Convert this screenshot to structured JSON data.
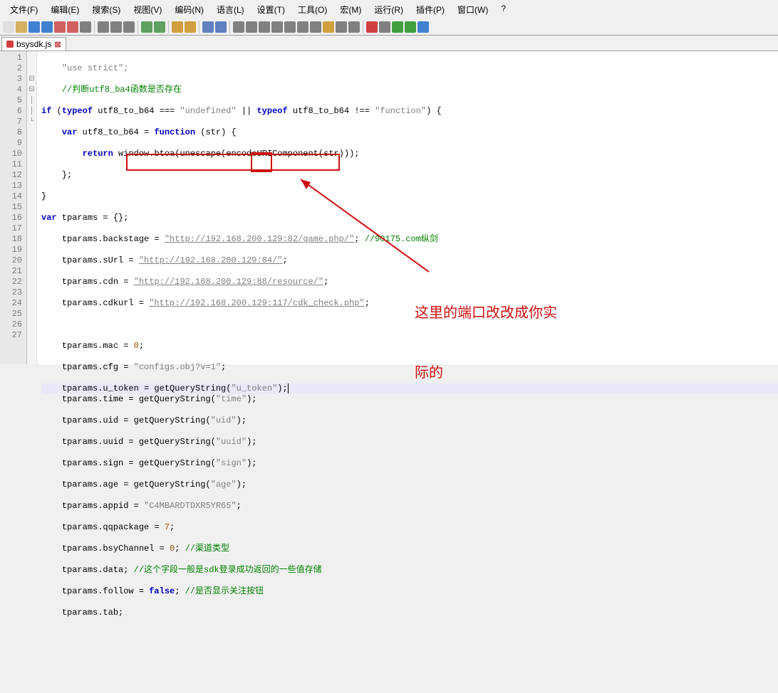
{
  "menu": {
    "file": "文件(F)",
    "edit": "编辑(E)",
    "search": "搜索(S)",
    "view": "视图(V)",
    "encoding": "编码(N)",
    "lang": "语言(L)",
    "settings": "设置(T)",
    "tools": "工具(O)",
    "macro": "宏(M)",
    "run": "运行(R)",
    "plugins": "插件(P)",
    "window": "窗口(W)",
    "help": "?"
  },
  "tab": {
    "name": "bsysdk.js"
  },
  "annotation": {
    "line1": "这里的端口改改成你实",
    "line2": "际的"
  },
  "code": {
    "l1": "\"use strict\";",
    "l2": "//判断utf8_ba4函数是否存在",
    "l3_a": "if",
    "l3_b": " (",
    "l3_c": "typeof",
    "l3_d": " utf8_to_b64 === ",
    "l3_e": "\"undefined\"",
    "l3_f": " || ",
    "l3_g": "typeof",
    "l3_h": " utf8_to_b64 !== ",
    "l3_i": "\"function\"",
    "l3_j": ") {",
    "l4_a": "var",
    "l4_b": " utf8_to_b64 = ",
    "l4_c": "function",
    "l4_d": " (str) {",
    "l5_a": "return",
    "l5_b": " window.btoa(unescape(encodeURIComponent(str)));",
    "l6": "};",
    "l7": "}",
    "l8_a": "var",
    "l8_b": " tparams = {};",
    "l9_a": "tparams.backstage = ",
    "l9_b": "\"http://192.168.200.129:82/game.php/\"",
    "l9_c": "; ",
    "l9_d": "//90175.com纵剑",
    "l10_a": "tparams.sUrl = ",
    "l10_b": "\"http://192.168.200.129:84/\"",
    "l10_c": ";",
    "l11_a": "tparams.cdn = ",
    "l11_b": "\"http://192.168.200.129:88/resource/\"",
    "l11_c": ";",
    "l12_a": "tparams.cdkurl = ",
    "l12_b": "\"http://192.168.200.129:117/cdk_check.php\"",
    "l12_c": ";",
    "l14_a": "tparams.mac = ",
    "l14_b": "0",
    "l14_c": ";",
    "l15_a": "tparams.cfg = ",
    "l15_b": "\"configs.obj?v=1\"",
    "l15_c": ";",
    "l16_a": "tparams.u_token = getQueryString(",
    "l16_b": "\"u_token\"",
    "l16_c": ");",
    "l17_a": "tparams.time = getQueryString(",
    "l17_b": "\"time\"",
    "l17_c": ");",
    "l18_a": "tparams.uid = getQueryString(",
    "l18_b": "\"uid\"",
    "l18_c": ");",
    "l19_a": "tparams.uuid = getQueryString(",
    "l19_b": "\"uuid\"",
    "l19_c": ");",
    "l20_a": "tparams.sign = getQueryString(",
    "l20_b": "\"sign\"",
    "l20_c": ");",
    "l21_a": "tparams.age = getQueryString(",
    "l21_b": "\"age\"",
    "l21_c": ");",
    "l22_a": "tparams.appid = ",
    "l22_b": "\"C4MBARDTDXR5YR65\"",
    "l22_c": ";",
    "l23_a": "tparams.qqpackage = ",
    "l23_b": "7",
    "l23_c": ";",
    "l24_a": "tparams.bsyChannel = ",
    "l24_b": "0",
    "l24_c": "; ",
    "l24_d": "//渠道类型",
    "l25_a": "tparams.data; ",
    "l25_b": "//这个字段一般是sdk登录成功返回的一些值存储",
    "l26_a": "tparams.follow = ",
    "l26_b": "false",
    "l26_c": "; ",
    "l26_d": "//是否显示关注按钮",
    "l27": "tparams.tab;"
  },
  "icons": {
    "new": "#e0e0e0",
    "open": "#d4b060",
    "save": "#4080d0",
    "saveall": "#4080d0",
    "close": "#d06060",
    "closeall": "#d06060",
    "print": "#808080",
    "cut": "#808080",
    "copy": "#808080",
    "paste": "#808080",
    "undo": "#60a060",
    "redo": "#60a060",
    "find": "#d0a040",
    "replace": "#d0a040",
    "zoomin": "#6080c0",
    "zoomout": "#6080c0",
    "wrap": "#808080",
    "allchars": "#808080",
    "indent": "#808080",
    "fold": "#808080",
    "record": "#d04040",
    "play": "#40a040",
    "run": "#808080"
  }
}
